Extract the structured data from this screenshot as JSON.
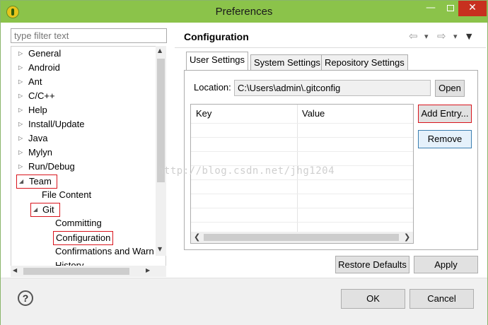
{
  "window": {
    "title": "Preferences",
    "minimize_glyph": "—",
    "close_glyph": "✕",
    "colors": {
      "titlebar": "#8bc34a",
      "close": "#c7301f",
      "highlight_box": "#d9141c"
    }
  },
  "filter": {
    "placeholder": "type filter text"
  },
  "tree": {
    "items": [
      {
        "label": "General",
        "expander": "▷"
      },
      {
        "label": "Android",
        "expander": "▷"
      },
      {
        "label": "Ant",
        "expander": "▷"
      },
      {
        "label": "C/C++",
        "expander": "▷"
      },
      {
        "label": "Help",
        "expander": "▷"
      },
      {
        "label": "Install/Update",
        "expander": "▷"
      },
      {
        "label": "Java",
        "expander": "▷"
      },
      {
        "label": "Mylyn",
        "expander": "▷"
      },
      {
        "label": "Run/Debug",
        "expander": "▷"
      },
      {
        "label": "Team",
        "expander": "◢"
      },
      {
        "label": "File Content",
        "expander": ""
      },
      {
        "label": "Git",
        "expander": "◢"
      },
      {
        "label": "Committing",
        "expander": ""
      },
      {
        "label": "Configuration",
        "expander": ""
      },
      {
        "label": "Confirmations and Warn",
        "expander": ""
      },
      {
        "label": "History",
        "expander": ""
      }
    ],
    "scroll_up": "▲",
    "scroll_down": "▼",
    "scroll_left": "◀",
    "scroll_right": "▶"
  },
  "page": {
    "title": "Configuration",
    "nav": {
      "back": "⇦",
      "back_menu": "▾",
      "forward": "⇨",
      "forward_menu": "▾",
      "view_menu": "▼"
    }
  },
  "tabs": [
    {
      "label": "User Settings",
      "active": true
    },
    {
      "label": "System Settings",
      "active": false
    },
    {
      "label": "Repository Settings",
      "active": false
    }
  ],
  "location": {
    "label": "Location:",
    "value": "C:\\Users\\admin\\.gitconfig",
    "open_label": "Open"
  },
  "table": {
    "columns": [
      "Key",
      "Value"
    ],
    "rows": [],
    "scroll_left": "❮",
    "scroll_right": "❯"
  },
  "actions": {
    "add_entry": "Add Entry...",
    "remove": "Remove"
  },
  "watermark": "http://blog.csdn.net/jhg1204",
  "footer": {
    "restore_defaults": "Restore Defaults",
    "apply": "Apply",
    "ok": "OK",
    "cancel": "Cancel",
    "help_glyph": "?"
  }
}
